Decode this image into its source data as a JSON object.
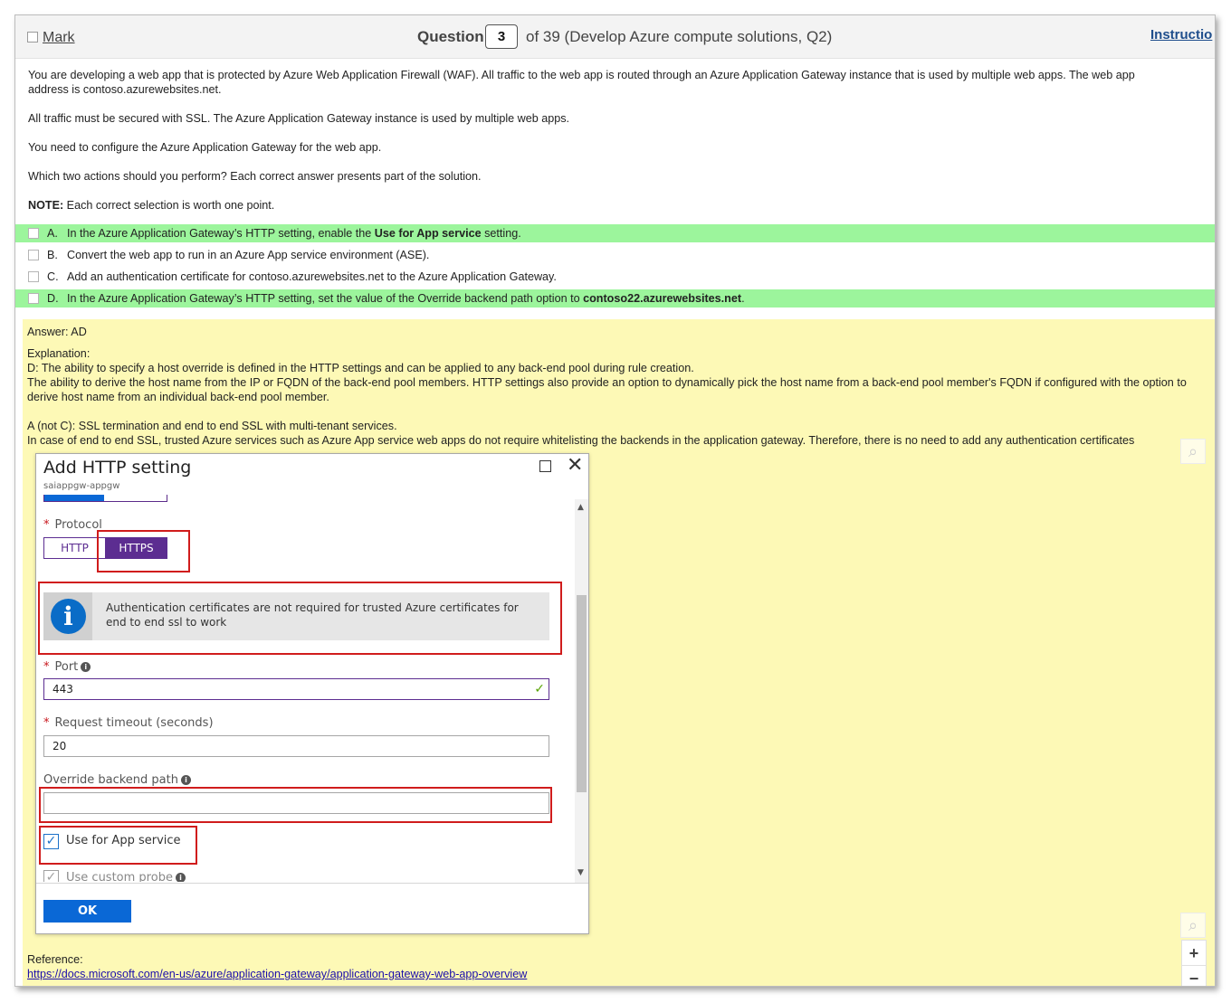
{
  "header": {
    "mark_label": "Mark",
    "question_label": "Question",
    "question_number": "3",
    "question_of": "of 39 (Develop Azure compute solutions, Q2)",
    "instructions_label": "Instructio"
  },
  "question": {
    "paragraph1_line1": "You are developing a web app that is protected by Azure Web Application Firewall (WAF). All traffic to the web app is routed through an Azure Application Gateway instance that is used by multiple web apps. The web app",
    "paragraph1_line2": "address is contoso.azurewebsites.net.",
    "paragraph2": "All traffic must be secured with SSL. The Azure Application Gateway instance is used by multiple web apps.",
    "paragraph3": "You need to configure the Azure Application Gateway for the web app.",
    "paragraph4": "Which two actions should you perform? Each correct answer presents part of the solution.",
    "note_label": "NOTE:",
    "note_text": " Each correct selection is worth one point."
  },
  "options": [
    {
      "letter": "A.",
      "text_before": "In the Azure Application Gateway’s HTTP setting, enable the ",
      "bold": "Use for App service",
      "text_after": " setting.",
      "correct": true
    },
    {
      "letter": "B.",
      "text_before": "Convert the web app to run in an Azure App service environment (ASE).",
      "bold": "",
      "text_after": "",
      "correct": false
    },
    {
      "letter": "C.",
      "text_before": "Add an authentication certificate for contoso.azurewebsites.net to the Azure Application Gateway.",
      "bold": "",
      "text_after": "",
      "correct": false
    },
    {
      "letter": "D.",
      "text_before": "In the Azure Application Gateway’s HTTP setting, set the value of the Override backend path option to ",
      "bold": "contoso22.azurewebsites.net",
      "text_after": ".",
      "correct": true
    }
  ],
  "answer": {
    "answer_line": "Answer: AD",
    "explanation_label": "Explanation:",
    "d_line": "D: The ability to specify a host override is defined in the HTTP settings and can be applied to any back-end pool during rule creation.",
    "d_detail": "The ability to derive the host name from the IP or FQDN of the back-end pool members. HTTP settings also provide an option to dynamically pick the host name from a back-end pool member's FQDN if configured with the option to derive host name from an individual back-end pool member.",
    "a_line": "A (not C): SSL termination and end to end SSL with multi-tenant services.",
    "a_detail": "In case of end to end SSL, trusted Azure services such as Azure App service web apps do not require whitelisting the backends in the application gateway. Therefore, there is no need to add any authentication certificates",
    "reference_label": "Reference:",
    "reference_url": "https://docs.microsoft.com/en-us/azure/application-gateway/application-gateway-web-app-overview"
  },
  "dialog": {
    "title": "Add HTTP setting",
    "subtitle": "saiappgw-appgw",
    "protocol_label": "Protocol",
    "protocol_http": "HTTP",
    "protocol_https": "HTTPS",
    "info_message": "Authentication certificates are not required for trusted Azure certificates for end to end ssl to work",
    "port_label": "Port",
    "port_value": "443",
    "timeout_label": "Request timeout (seconds)",
    "timeout_value": "20",
    "override_label": "Override backend path",
    "override_value": "",
    "use_app_service_label": "Use for App service",
    "use_custom_probe_label": "Use custom probe",
    "ok_label": "OK"
  },
  "colors": {
    "correct_highlight": "#9cf59c",
    "answer_background": "#fdf9b6",
    "accent_purple": "#5c2d91",
    "azure_blue": "#0a68d6",
    "callout_red": "#d01c1c"
  },
  "icons": {
    "zoom": "magnifier-icon",
    "info": "info-icon",
    "check": "checkmark-icon"
  }
}
